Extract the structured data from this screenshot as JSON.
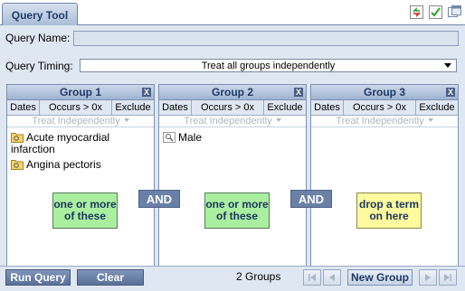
{
  "title_tab": "Query Tool",
  "title_icons": [
    "sync-icon",
    "check-icon",
    "copy-window-icon"
  ],
  "query_name": {
    "label": "Query Name:",
    "value": ""
  },
  "query_timing": {
    "label": "Query Timing:",
    "selected": "Treat all groups independently"
  },
  "groups": [
    {
      "title": "Group 1",
      "close": "X",
      "buttons": {
        "dates": "Dates",
        "occurs": "Occurs > 0x",
        "exclude": "Exclude"
      },
      "treat": "Treat Independently",
      "terms": [
        "Acute myocardial infarction",
        "Angina pectoris"
      ],
      "hint": "one or more of these"
    },
    {
      "title": "Group 2",
      "close": "X",
      "buttons": {
        "dates": "Dates",
        "occurs": "Occurs > 0x",
        "exclude": "Exclude"
      },
      "treat": "Treat Independently",
      "terms": [
        "Male"
      ],
      "hint": "one or more of these"
    },
    {
      "title": "Group 3",
      "close": "X",
      "buttons": {
        "dates": "Dates",
        "occurs": "Occurs > 0x",
        "exclude": "Exclude"
      },
      "treat": "Treat Independently",
      "terms": [],
      "hint": "drop a term on here"
    }
  ],
  "and_labels": [
    "AND",
    "AND"
  ],
  "footer": {
    "run_query": "Run Query",
    "clear": "Clear",
    "groups_count": "2 Groups",
    "new_group": "New Group"
  },
  "colors": {
    "accent": "#6a80a6",
    "hint_green": "#a9ef9f",
    "hint_yellow": "#fdfb9d",
    "panel_bg": "#dfe7f2"
  }
}
